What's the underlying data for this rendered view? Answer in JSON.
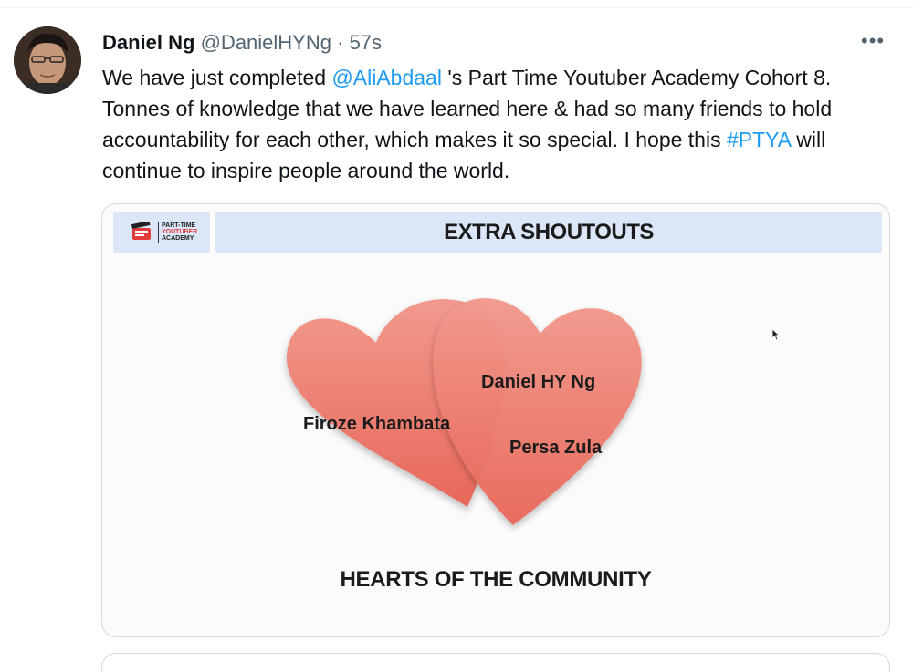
{
  "tweet": {
    "author_name": "Daniel Ng",
    "author_handle": "@DanielHYNg",
    "separator": "·",
    "time": "57s",
    "more_icon": "more-horizontal-icon",
    "text": {
      "part1": "We have just completed ",
      "mention": "@AliAbdaal",
      "part2": " 's Part Time Youtuber Academy Cohort 8. Tonnes of knowledge that we have learned here & had so many friends to hold accountability for each other, which makes it so special. I hope this ",
      "hashtag": "#PTYA",
      "part3": " will continue to inspire people around the world."
    }
  },
  "media": {
    "logo": {
      "line1": "PART-TIME",
      "line2": "YOUTUBER",
      "line3": "ACADEMY"
    },
    "title": "EXTRA SHOUTOUTS",
    "names": [
      "Daniel HY Ng",
      "Firoze Khambata",
      "Persa Zula"
    ],
    "caption": "HEARTS OF THE COMMUNITY"
  },
  "colors": {
    "link": "#1d9bf0",
    "heart": "#ec7a6c",
    "banner": "#dbe7f6"
  }
}
